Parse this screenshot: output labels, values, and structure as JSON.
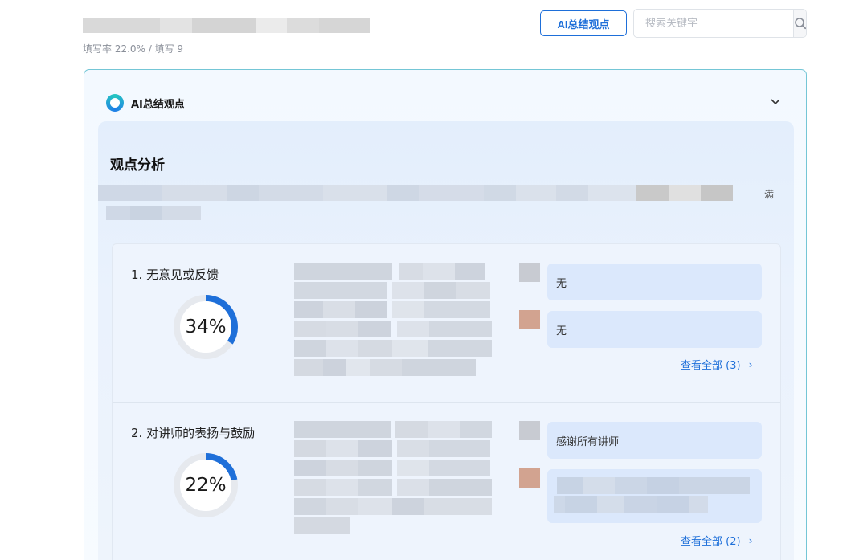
{
  "header": {
    "stats": "填写率 22.0% / 填写 9",
    "ai_button_label": "AI总结观点",
    "search_placeholder": "搜索关键字"
  },
  "ai_panel": {
    "label": "AI总结观点",
    "analysis": {
      "title": "观点分析",
      "tail_char": "满"
    }
  },
  "categories": [
    {
      "title": "1. 无意见或反馈",
      "percent_value": 34,
      "percent_label": "34%",
      "replies": [
        "无",
        "无"
      ],
      "view_all": "查看全部 (3)"
    },
    {
      "title": "2. 对讲师的表扬与鼓励",
      "percent_value": 22,
      "percent_label": "22%",
      "replies": [
        "感谢所有讲师",
        ""
      ],
      "view_all": "查看全部 (2)"
    }
  ],
  "colors": {
    "accent": "#1e6fd9",
    "donut_track": "#e6e9ee",
    "bubble": "#dbe8fc",
    "avatar_gray": "#c8cbd2",
    "avatar_tan": "#d2a390"
  }
}
